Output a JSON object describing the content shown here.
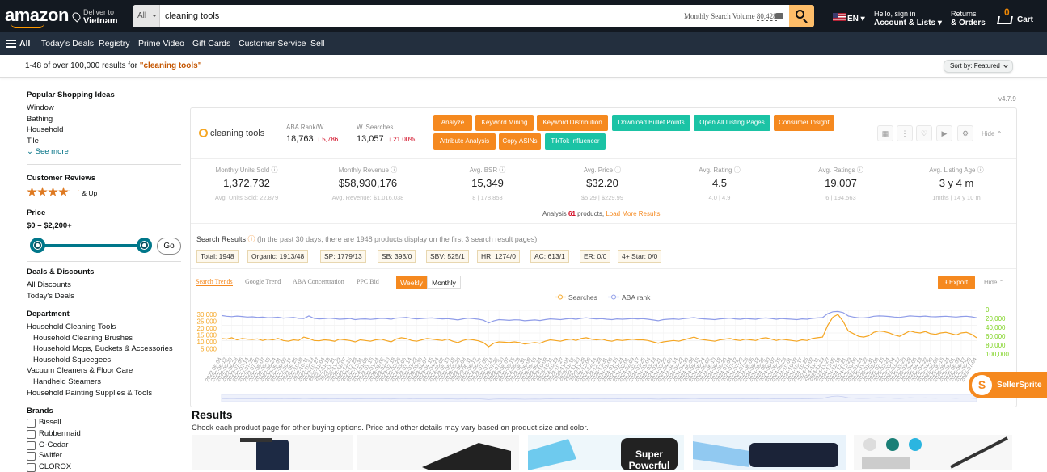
{
  "header": {
    "logo": "amazon",
    "deliver_to_label": "Deliver to",
    "deliver_to_value": "Vietnam",
    "search_category": "All",
    "search_value": "cleaning tools",
    "monthly_volume_label": "Monthly Search Volume",
    "monthly_volume_value": "80,428",
    "language": "EN",
    "account_line1": "Hello, sign in",
    "account_line2": "Account & Lists",
    "returns_line1": "Returns",
    "returns_line2": "& Orders",
    "cart_count": "0",
    "cart_label": "Cart"
  },
  "nav": {
    "all": "All",
    "items": [
      "Today's Deals",
      "Registry",
      "Prime Video",
      "Gift Cards",
      "Customer Service",
      "Sell"
    ]
  },
  "results_bar": {
    "summary": "1-48 of over 100,000 results for ",
    "query": "\"cleaning tools\"",
    "sort_label": "Sort by:  Featured"
  },
  "sidebar": {
    "popular_heading": "Popular Shopping Ideas",
    "popular_items": [
      "Window",
      "Bathing",
      "Household",
      "Tile"
    ],
    "see_more": "See more",
    "reviews_heading": "Customer Reviews",
    "reviews_up": "& Up",
    "reviews_rating": 4,
    "price_heading": "Price",
    "price_range": "$0 – $2,200+",
    "go_label": "Go",
    "deals_heading": "Deals & Discounts",
    "deals_items": [
      "All Discounts",
      "Today's Deals"
    ],
    "department_heading": "Department",
    "department_items": [
      {
        "label": "Household Cleaning Tools",
        "indent": 0
      },
      {
        "label": "Household Cleaning Brushes",
        "indent": 1
      },
      {
        "label": "Household Mops, Buckets & Accessories",
        "indent": 1
      },
      {
        "label": "Household Squeegees",
        "indent": 1
      },
      {
        "label": "Vacuum Cleaners & Floor Care",
        "indent": 0
      },
      {
        "label": "Handheld Steamers",
        "indent": 1
      },
      {
        "label": "Household Painting Supplies & Tools",
        "indent": 0
      }
    ],
    "brands_heading": "Brands",
    "brands_items": [
      "Bissell",
      "Rubbermaid",
      "O-Cedar",
      "Swiffer",
      "CLOROX"
    ]
  },
  "sellersprite": {
    "version": "v4.7.9",
    "keyword": "cleaning tools",
    "aba_rank_label": "ABA Rank/W",
    "aba_rank_value": "18,763",
    "aba_rank_delta": "↓ 5,786",
    "w_searches_label": "W. Searches",
    "w_searches_value": "13,057",
    "w_searches_delta": "↓ 21.00%",
    "tools_row1": [
      {
        "label": "Analyze",
        "color": "orange"
      },
      {
        "label": "Keyword Mining",
        "color": "orange"
      },
      {
        "label": "Keyword Distribution",
        "color": "orange"
      },
      {
        "label": "Download Bullet Points",
        "color": "green"
      },
      {
        "label": "Open All Listing Pages",
        "color": "green"
      },
      {
        "label": "Consumer Insight",
        "color": "orange"
      }
    ],
    "tools_row2": [
      {
        "label": "Attribute Analysis",
        "color": "orange"
      },
      {
        "label": "Copy ASINs",
        "color": "orange"
      },
      {
        "label": "TikTok Influencer",
        "color": "green"
      }
    ],
    "hide_label": "Hide",
    "metrics": [
      {
        "label": "Monthly Units Sold",
        "value": "1,372,732",
        "sub": "Avg. Units Sold: 22,879"
      },
      {
        "label": "Monthly Revenue",
        "value": "$58,930,176",
        "sub": "Avg. Revenue: $1,016,038"
      },
      {
        "label": "Avg. BSR",
        "value": "15,349",
        "sub": "8  |  178,853"
      },
      {
        "label": "Avg. Price",
        "value": "$32.20",
        "sub": "$5.29  |  $229.99"
      },
      {
        "label": "Avg. Rating",
        "value": "4.5",
        "sub": "4.0  |  4.9"
      },
      {
        "label": "Avg. Ratings",
        "value": "19,007",
        "sub": "6  |  194,563"
      },
      {
        "label": "Avg. Listing Age",
        "value": "3 y 4 m",
        "sub": "1mths  |  14 y 10 m"
      }
    ],
    "analysis_prefix": "Analysis",
    "analysis_count": "61",
    "analysis_suffix": "products,",
    "load_more": "Load More Results",
    "search_results_label": "Search Results",
    "search_results_note": "(In the past 30 days, there are 1948 products display on the first 3 search result pages)",
    "chips": [
      "Total: 1948",
      "Organic: 1913/48",
      "SP: 1779/13",
      "SB: 393/0",
      "SBV: 525/1",
      "HR: 1274/0",
      "AC: 613/1",
      "ER: 0/0",
      "4+ Star: 0/0"
    ],
    "chart_tabs": [
      "Search Trends",
      "Google Trend",
      "ABA Concentration",
      "PPC Bid"
    ],
    "period_tabs": [
      "Weekly",
      "Monthly"
    ],
    "export_label": "Export",
    "hide2_label": "Hide",
    "brand_badge": "SellerSprite",
    "orange": "#f5891f",
    "green": "#1bc3a5"
  },
  "chart_data": {
    "type": "line",
    "series": [
      {
        "name": "Searches",
        "color": "#f5a623",
        "axis": "left"
      },
      {
        "name": "ABA rank",
        "color": "#8f9ce8",
        "axis": "right"
      }
    ],
    "left_ticks": [
      "30,000",
      "25,000",
      "20,000",
      "15,000",
      "10,000",
      "5,000"
    ],
    "right_ticks": [
      "0",
      "20,000",
      "40,000",
      "60,000",
      "80,000",
      "100,000"
    ],
    "ylim_left": [
      0,
      33000
    ],
    "ylim_right": [
      0,
      110000
    ],
    "x_start": "2022-06-04",
    "x_end": "2025-07-04",
    "searches": [
      12500,
      12000,
      13000,
      11500,
      12500,
      12000,
      11800,
      12200,
      11000,
      12000,
      11500,
      12500,
      11000,
      10500,
      11500,
      11000,
      13500,
      12500,
      11000,
      10800,
      11500,
      11200,
      10500,
      12000,
      11500,
      11000,
      10000,
      11500,
      11000,
      10500,
      11500,
      12000,
      11000,
      10000,
      12000,
      13000,
      12500,
      11000,
      10500,
      11500,
      12500,
      12000,
      11500,
      11000,
      12000,
      10500,
      9500,
      11000,
      12000,
      11500,
      10800,
      9500,
      6500,
      9000,
      10000,
      9800,
      9500,
      10000,
      9500,
      8500,
      9000,
      9500,
      9000,
      10500,
      11500,
      11000,
      10500,
      11500,
      12000,
      11000,
      12500,
      13000,
      12000,
      11500,
      12000,
      11000,
      10500,
      11500,
      11000,
      11500,
      12000,
      11500,
      11500,
      11000,
      10000,
      9000,
      10000,
      10500,
      11000,
      10500,
      11500,
      12500,
      13500,
      12000,
      11500,
      11000,
      10500,
      11500,
      12000,
      12500,
      11500,
      11000,
      12000,
      11500,
      11000,
      12500,
      13000,
      12000,
      11000,
      12000,
      11500,
      11000,
      10500,
      11500,
      11000,
      12500,
      13000,
      13500,
      22000,
      28000,
      30000,
      25000,
      18000,
      16000,
      14000,
      13500,
      14500,
      17000,
      18000,
      17500,
      16500,
      15000,
      14000,
      16000,
      18000,
      17000,
      16500,
      17500,
      16000,
      15500,
      16500,
      17000,
      16000,
      15000,
      16500,
      17000,
      15500,
      13000
    ],
    "aba_rank": [
      2000,
      4000,
      5000,
      3500,
      4500,
      6000,
      5500,
      7000,
      6000,
      8000,
      7500,
      6500,
      9000,
      8000,
      7000,
      9500,
      10000,
      3000,
      9500,
      11000,
      10500,
      9000,
      10500,
      12000,
      11000,
      10000,
      13000,
      11500,
      11000,
      12500,
      11000,
      9500,
      10000,
      12000,
      9000,
      8000,
      7000,
      9500,
      11000,
      10000,
      9000,
      8500,
      10000,
      11000,
      10500,
      12000,
      14000,
      11000,
      9000,
      10500,
      12000,
      14500,
      22000,
      16500,
      13000,
      14000,
      15000,
      13500,
      14000,
      16000,
      15000,
      14000,
      15500,
      13000,
      11000,
      12000,
      13000,
      11000,
      10000,
      12000,
      9500,
      8000,
      10000,
      11000,
      10500,
      12000,
      13000,
      11000,
      12000,
      11000,
      10000,
      11000,
      10500,
      12000,
      14000,
      16000,
      13000,
      12000,
      11000,
      12500,
      10500,
      9000,
      7500,
      10000,
      11000,
      12000,
      13000,
      11000,
      10000,
      9000,
      11000,
      12000,
      10000,
      11000,
      12000,
      9500,
      8500,
      10000,
      12000,
      10000,
      11000,
      12000,
      13000,
      11000,
      12000,
      9500,
      8500,
      7500,
      -3000,
      -8000,
      -9000,
      -6000,
      3000,
      6000,
      8000,
      8500,
      7000,
      4000,
      3000,
      3500,
      4500,
      6000,
      7000,
      5000,
      3000,
      4000,
      4500,
      3500,
      5000,
      5500,
      4500,
      4000,
      5000,
      6000,
      4500,
      4000,
      5500,
      8000
    ]
  }
}
